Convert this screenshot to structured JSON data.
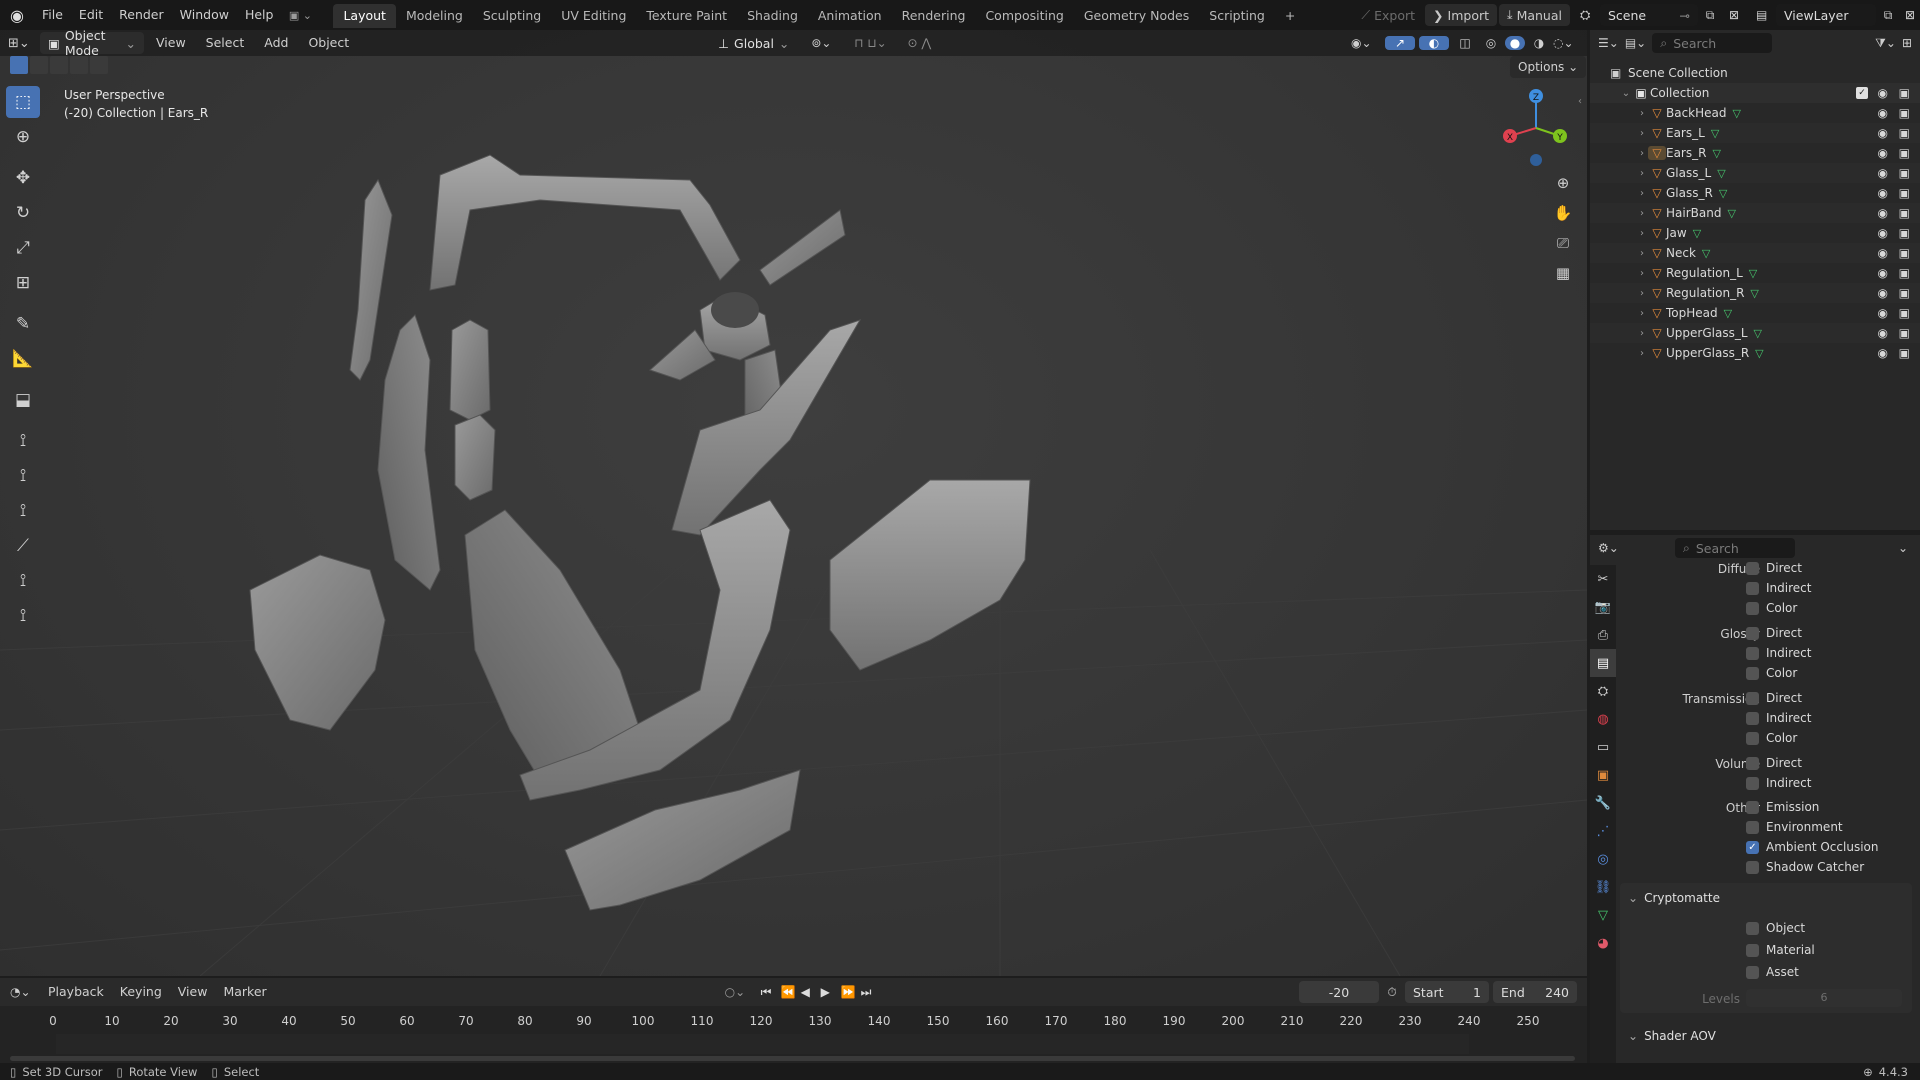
{
  "topbar": {
    "menus": [
      "File",
      "Edit",
      "Render",
      "Window",
      "Help"
    ],
    "workspaces": [
      "Layout",
      "Modeling",
      "Sculpting",
      "UV Editing",
      "Texture Paint",
      "Shading",
      "Animation",
      "Rendering",
      "Compositing",
      "Geometry Nodes",
      "Scripting"
    ],
    "add_tab": "+",
    "export_label": "Export",
    "import_label": "Import",
    "manual_label": "Manual",
    "scene_name": "Scene",
    "view_layer": "ViewLayer"
  },
  "viewport": {
    "mode": "Object Mode",
    "menus": [
      "View",
      "Select",
      "Add",
      "Object"
    ],
    "orientation": "Global",
    "options_label": "Options",
    "info_line1": "User Perspective",
    "info_line2": "(-20) Collection | Ears_R",
    "gizmo": {
      "x": "X",
      "y": "Y",
      "z": "Z"
    }
  },
  "outliner": {
    "search_placeholder": "Search",
    "scene_collection": "Scene Collection",
    "collection": "Collection",
    "objects": [
      "BackHead",
      "Ears_L",
      "Ears_R",
      "Glass_L",
      "Glass_R",
      "HairBand",
      "Jaw",
      "Neck",
      "Regulation_L",
      "Regulation_R",
      "TopHead",
      "UpperGlass_L",
      "UpperGlass_R"
    ]
  },
  "properties": {
    "search_placeholder": "Search",
    "groups": [
      {
        "label": "Diffuse",
        "items": [
          {
            "name": "Direct",
            "checked": false
          },
          {
            "name": "Indirect",
            "checked": false
          },
          {
            "name": "Color",
            "checked": false
          }
        ]
      },
      {
        "label": "Glossy",
        "items": [
          {
            "name": "Direct",
            "checked": false
          },
          {
            "name": "Indirect",
            "checked": false
          },
          {
            "name": "Color",
            "checked": false
          }
        ]
      },
      {
        "label": "Transmission",
        "items": [
          {
            "name": "Direct",
            "checked": false
          },
          {
            "name": "Indirect",
            "checked": false
          },
          {
            "name": "Color",
            "checked": false
          }
        ]
      },
      {
        "label": "Volume",
        "items": [
          {
            "name": "Direct",
            "checked": false
          },
          {
            "name": "Indirect",
            "checked": false
          }
        ]
      },
      {
        "label": "Other",
        "items": [
          {
            "name": "Emission",
            "checked": false
          },
          {
            "name": "Environment",
            "checked": false
          },
          {
            "name": "Ambient Occlusion",
            "checked": true
          },
          {
            "name": "Shadow Catcher",
            "checked": false
          }
        ]
      }
    ],
    "cryptomatte": {
      "title": "Cryptomatte",
      "items": [
        "Object",
        "Material",
        "Asset"
      ],
      "levels_label": "Levels",
      "levels_value": "6"
    },
    "shader_aov": "Shader AOV"
  },
  "timeline": {
    "menus": [
      "Playback",
      "Keying",
      "View",
      "Marker"
    ],
    "current_frame": "-20",
    "start_label": "Start",
    "start_value": "1",
    "end_label": "End",
    "end_value": "240",
    "ticks": [
      "0",
      "10",
      "20",
      "30",
      "40",
      "50",
      "60",
      "70",
      "80",
      "90",
      "100",
      "110",
      "120",
      "130",
      "140",
      "150",
      "160",
      "170",
      "180",
      "190",
      "200",
      "210",
      "220",
      "230",
      "240",
      "250"
    ]
  },
  "statusbar": {
    "hint1": "Set 3D Cursor",
    "hint2": "Rotate View",
    "hint3": "Select",
    "version": "4.4.3"
  },
  "colors": {
    "accent": "#4772b3",
    "object_orange": "#e08a3c",
    "mesh_green": "#46c46c",
    "axis_x": "#e0414f",
    "axis_y": "#7ec31e",
    "axis_z": "#3f8fe0"
  }
}
